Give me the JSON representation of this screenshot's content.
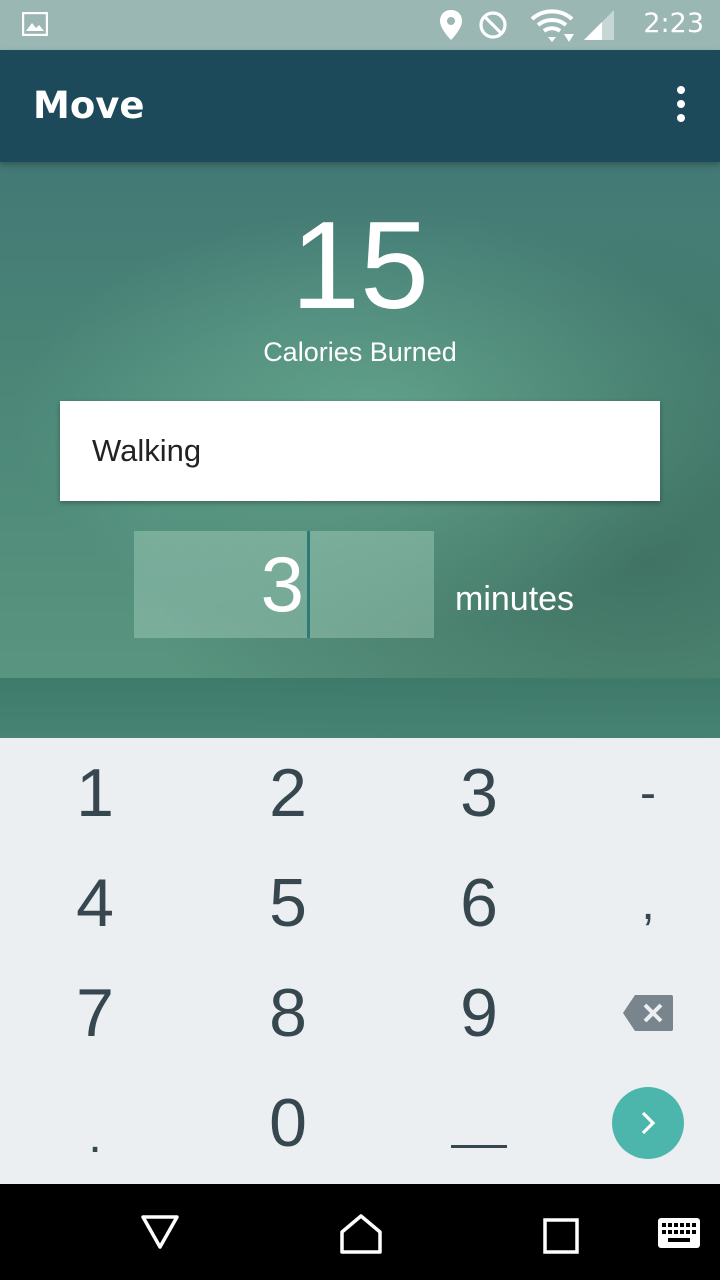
{
  "status_bar": {
    "time": "2:23",
    "icons": [
      "image-icon",
      "location-icon",
      "do-not-disturb-icon",
      "wifi-icon",
      "cell-signal-icon"
    ]
  },
  "app_bar": {
    "title": "Move",
    "menu_icon": "overflow-menu-icon"
  },
  "calories": {
    "value": "15",
    "label": "Calories Burned"
  },
  "activity": {
    "value": "Walking"
  },
  "duration": {
    "value": "3",
    "unit": "minutes"
  },
  "keypad": {
    "keys": [
      "1",
      "2",
      "3",
      "-",
      "4",
      "5",
      "6",
      ",",
      "7",
      "8",
      "9",
      "backspace",
      ".",
      "0",
      "space",
      "go"
    ]
  },
  "colors": {
    "app_bar": "#1c4a5a",
    "accent": "#4db6ac",
    "keypad_bg": "#eceff1",
    "key_text": "#37474f"
  },
  "nav_bar": {
    "icons": [
      "back-icon",
      "home-icon",
      "recents-icon",
      "keyboard-icon"
    ]
  }
}
